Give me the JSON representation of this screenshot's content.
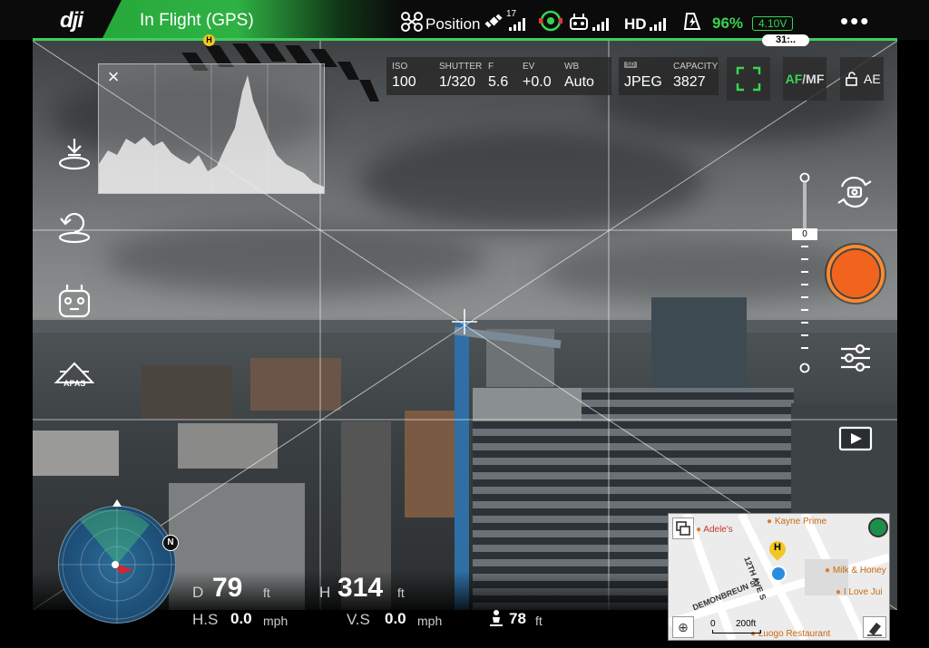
{
  "status_bar": {
    "logo": "dji",
    "flight_status": "In Flight (GPS)",
    "flight_mode": "Position",
    "satellites": "17",
    "video_link": "HD",
    "battery_percent": "96%",
    "voltage": "4.10V",
    "remaining_time": "31:..",
    "colors": {
      "ok": "#39d353",
      "banner": "#2fb244"
    }
  },
  "histogram": {
    "close_label": "×"
  },
  "camera_params": {
    "iso_label": "ISO",
    "iso": "100",
    "shutter_label": "SHUTTER",
    "shutter": "1/320",
    "f_label": "F",
    "f": "5.6",
    "ev_label": "EV",
    "ev": "+0.0",
    "wb_label": "WB",
    "wb": "Auto"
  },
  "storage": {
    "card": "SD",
    "format": "JPEG",
    "capacity_label": "CAPACITY",
    "capacity": "3827"
  },
  "buttons": {
    "af_mf": {
      "af": "AF",
      "sep": "/",
      "mf": "MF"
    },
    "ae": "AE"
  },
  "left_toolbar": {
    "apas": "APAS",
    "icons": [
      "takeoff-icon",
      "return-home-icon",
      "remote-controller-icon",
      "apas-icon"
    ]
  },
  "zoom": {
    "value": "0"
  },
  "radar": {
    "north": "N"
  },
  "telemetry": {
    "d_label": "D",
    "d_value": "79",
    "d_unit": "ft",
    "h_label": "H",
    "h_value": "314",
    "h_unit": "ft",
    "hs_label": "H.S",
    "hs_value": "0.0",
    "hs_unit": "mph",
    "vs_label": "V.S",
    "vs_value": "0.0",
    "vs_unit": "mph",
    "vps_value": "78",
    "vps_unit": "ft"
  },
  "map": {
    "pois": [
      "Adele's",
      "Kayne Prime",
      "Milk & Honey",
      "I Love Jui",
      "Luogo Restaurant"
    ],
    "streets": [
      "DEMONBREUN ST",
      "12TH AVE S"
    ],
    "home": "H",
    "scale": "200ft",
    "scale_zero": "0"
  }
}
